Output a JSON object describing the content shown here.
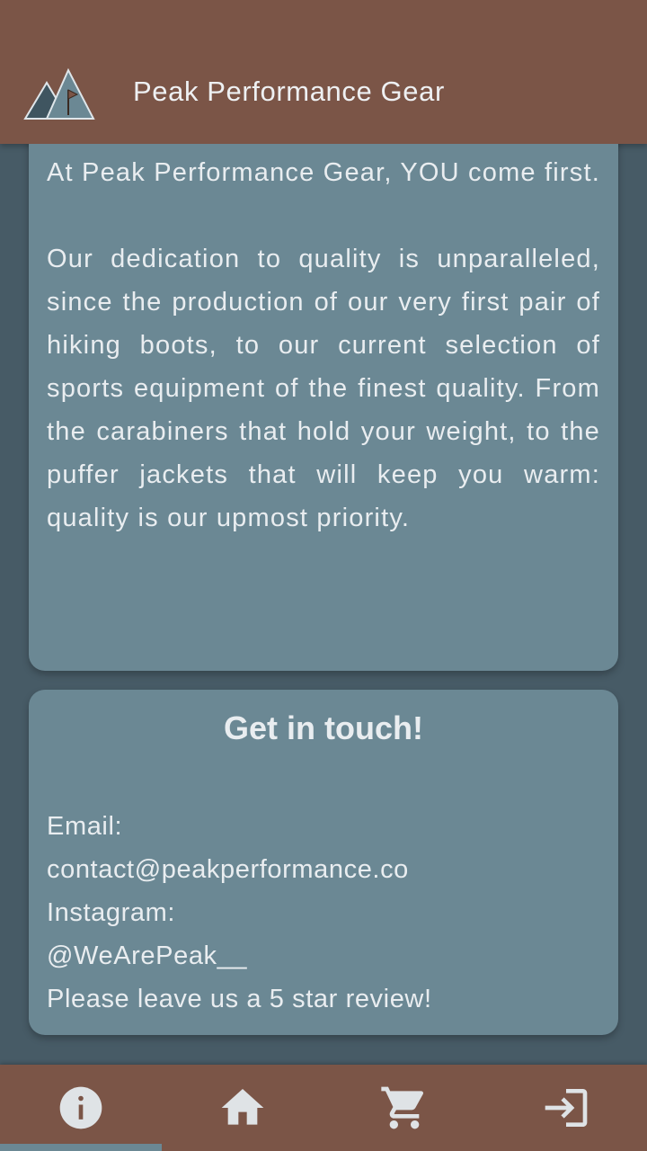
{
  "app_bar": {
    "title": "Peak Performance Gear",
    "logo_icon": "mountain-flag-icon"
  },
  "about": {
    "paragraphs": [
      "At Peak Performance Gear, YOU come first.",
      "Our dedication to quality is unparalleled, since the production of our very first pair of hiking boots, to our current selection of sports equipment of the finest quality. From the carabiners that hold your weight, to the puffer jackets that will keep you warm: quality is our upmost priority."
    ]
  },
  "contact": {
    "heading": "Get in touch!",
    "email_label": "Email:",
    "email": "contact@peakperformance.co",
    "instagram_label": "Instagram:",
    "instagram": "@WeArePeak__",
    "review_prompt": "Please leave us a 5 star review!"
  },
  "bottom_nav": {
    "items": [
      {
        "icon": "info-icon",
        "selected": true
      },
      {
        "icon": "home-icon",
        "selected": false
      },
      {
        "icon": "cart-icon",
        "selected": false
      },
      {
        "icon": "login-icon",
        "selected": false
      }
    ]
  },
  "colors": {
    "primary": "#7b5547",
    "background": "#475b66",
    "card": "#6b8894",
    "text": "#e9edf0"
  }
}
